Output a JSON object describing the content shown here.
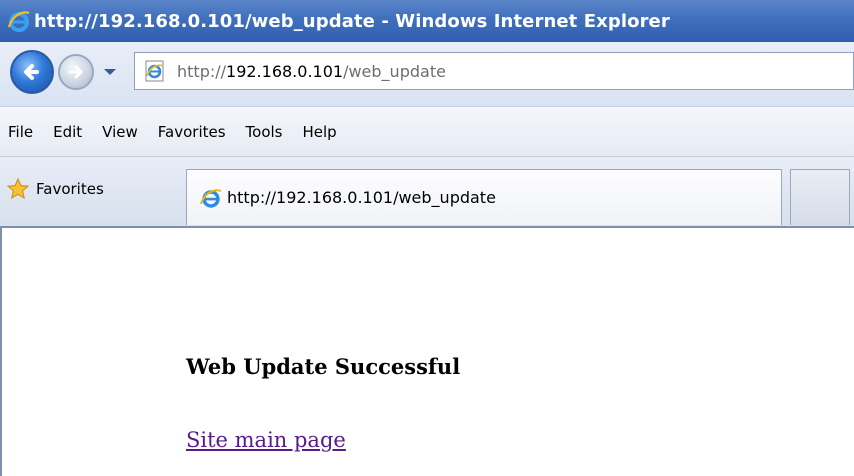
{
  "window": {
    "title": "http://192.168.0.101/web_update - Windows Internet Explorer",
    "icon": "ie-logo-icon"
  },
  "navigation": {
    "back_icon": "back-arrow-icon",
    "forward_icon": "forward-arrow-icon",
    "history_dropdown_icon": "chevron-down-icon"
  },
  "address_bar": {
    "page_icon": "ie-page-icon",
    "scheme": "http://",
    "host": "192.168.0.101",
    "path": "/web_update"
  },
  "menu": {
    "items": [
      "File",
      "Edit",
      "View",
      "Favorites",
      "Tools",
      "Help"
    ]
  },
  "favorites_bar": {
    "favorites_label": "Favorites",
    "favorites_icon": "star-icon"
  },
  "tabs": [
    {
      "label": "http://192.168.0.101/web_update",
      "icon": "ie-logo-icon"
    }
  ],
  "content": {
    "heading": "Web Update Successful",
    "link_text": "Site main page"
  },
  "colors": {
    "title_bar": "#3f6fbd",
    "visited_link": "#551a8b"
  }
}
